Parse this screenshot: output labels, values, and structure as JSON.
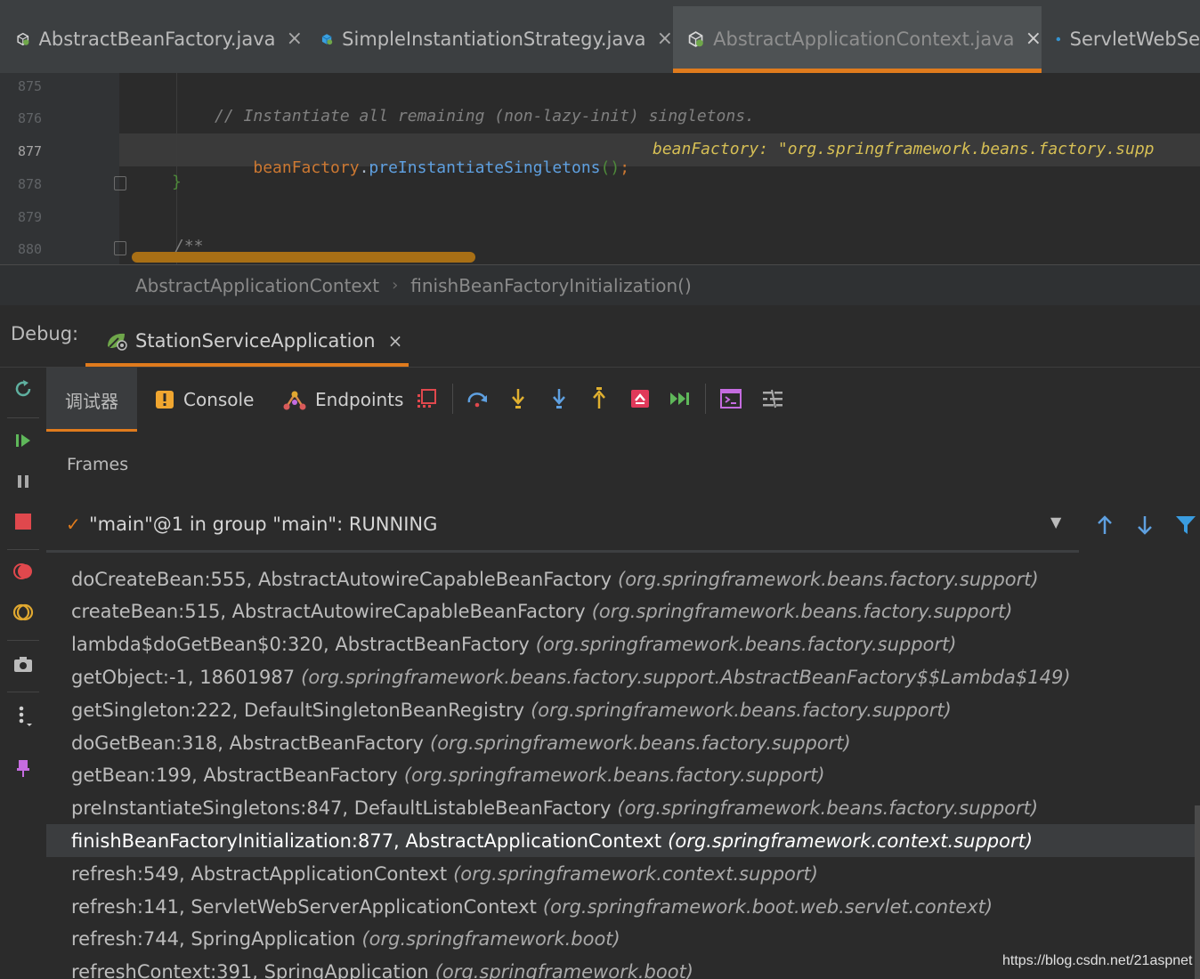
{
  "editor_tabs": [
    {
      "label": "AbstractBeanFactory.java",
      "close": "×",
      "icon": "class-icon",
      "active": false
    },
    {
      "label": "SimpleInstantiationStrategy.java",
      "close": "×",
      "icon": "class-icon",
      "active": false
    },
    {
      "label": "AbstractApplicationContext.java",
      "close": "×",
      "icon": "class-icon",
      "active": true
    },
    {
      "label": "ServletWebSe",
      "icon": "class-icon",
      "active": false
    }
  ],
  "code": {
    "line_numbers": [
      "875",
      "876",
      "877",
      "878",
      "879",
      "880"
    ],
    "comment_line": "// Instantiate all remaining (non-lazy-init) singletons.",
    "call_target": "beanFactory",
    "call_dot": ".",
    "call_method": "preInstantiateSingletons",
    "call_parens": "()",
    "call_semicolon": ";",
    "inline_value": "beanFactory: \"org.springframework.beans.factory.supp",
    "closing_brace": "}",
    "javadoc_start": "/**"
  },
  "breadcrumb": {
    "class": "AbstractApplicationContext",
    "separator": "›",
    "method": "finishBeanFactoryInitialization()"
  },
  "debug": {
    "label": "Debug:",
    "run_config": "StationServiceApplication",
    "run_close": "×",
    "tabs": {
      "debugger": "调试器",
      "console": "Console",
      "endpoints": "Endpoints"
    }
  },
  "frames": {
    "title": "Frames",
    "thread_check": "✓",
    "thread": "\"main\"@1 in group \"main\": RUNNING",
    "dropdown_arrow": "▼",
    "list": [
      {
        "method": "doCreateBean:555, AbstractAutowireCapableBeanFactory",
        "pkg": "(org.springframework.beans.factory.support)"
      },
      {
        "method": "createBean:515, AbstractAutowireCapableBeanFactory",
        "pkg": "(org.springframework.beans.factory.support)"
      },
      {
        "method": "lambda$doGetBean$0:320, AbstractBeanFactory",
        "pkg": "(org.springframework.beans.factory.support)"
      },
      {
        "method": "getObject:-1, 18601987",
        "pkg": "(org.springframework.beans.factory.support.AbstractBeanFactory$$Lambda$149)"
      },
      {
        "method": "getSingleton:222, DefaultSingletonBeanRegistry",
        "pkg": "(org.springframework.beans.factory.support)"
      },
      {
        "method": "doGetBean:318, AbstractBeanFactory",
        "pkg": "(org.springframework.beans.factory.support)"
      },
      {
        "method": "getBean:199, AbstractBeanFactory",
        "pkg": "(org.springframework.beans.factory.support)"
      },
      {
        "method": "preInstantiateSingletons:847, DefaultListableBeanFactory",
        "pkg": "(org.springframework.beans.factory.support)"
      },
      {
        "method": "finishBeanFactoryInitialization:877, AbstractApplicationContext",
        "pkg": "(org.springframework.context.support)",
        "selected": true
      },
      {
        "method": "refresh:549, AbstractApplicationContext",
        "pkg": "(org.springframework.context.support)"
      },
      {
        "method": "refresh:141, ServletWebServerApplicationContext",
        "pkg": "(org.springframework.boot.web.servlet.context)"
      },
      {
        "method": "refresh:744, SpringApplication",
        "pkg": "(org.springframework.boot)"
      },
      {
        "method": "refreshContext:391, SpringApplication",
        "pkg": "(org.springframework.boot)"
      }
    ]
  },
  "watermark": "https://blog.csdn.net/21aspnet",
  "colors": {
    "accent": "#e07b1d",
    "background": "#2b2b2b",
    "selected_frame": "#3b3d3f"
  }
}
